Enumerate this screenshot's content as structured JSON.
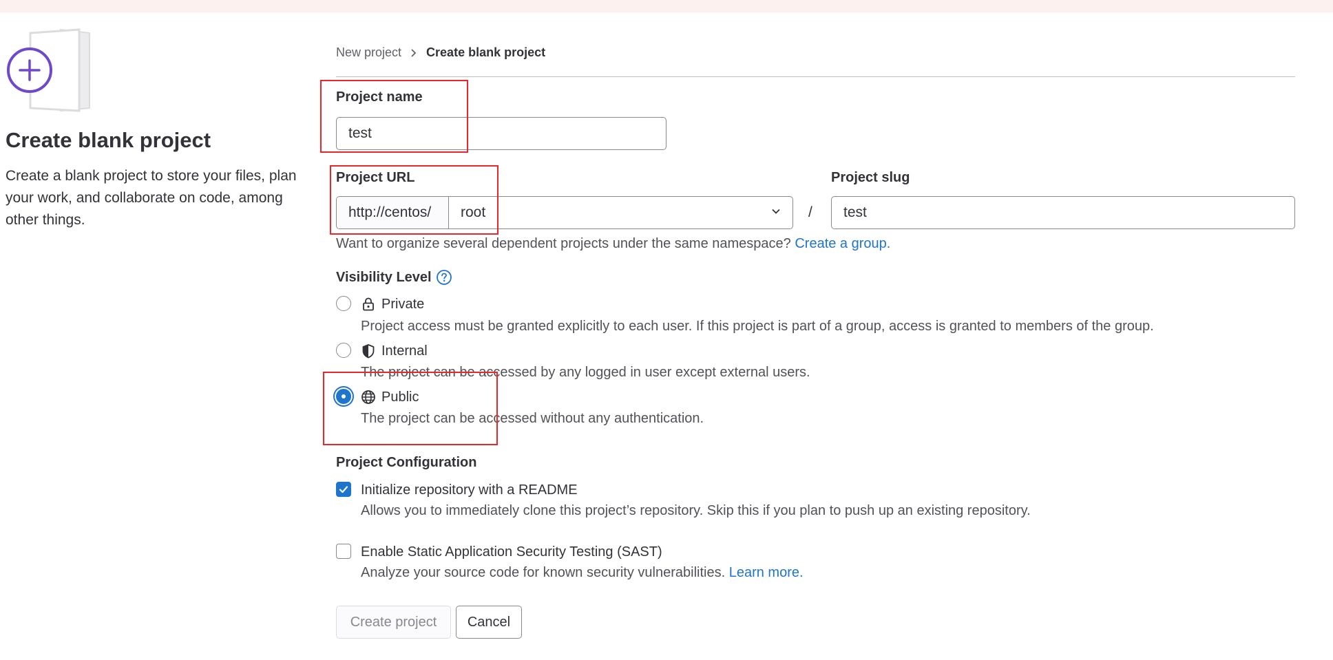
{
  "left_panel": {
    "title": "Create blank project",
    "description": "Create a blank project to store your files, plan your work, and collaborate on code, among other things."
  },
  "breadcrumb": {
    "parent": "New project",
    "current": "Create blank project"
  },
  "form": {
    "project_name_label": "Project name",
    "project_name_value": "test",
    "project_url_label": "Project URL",
    "url_prefix": "http://centos/",
    "namespace": "root",
    "slash": "/",
    "project_slug_label": "Project slug",
    "project_slug_value": "test",
    "namespace_help": "Want to organize several dependent projects under the same namespace?",
    "create_group_link": "Create a group."
  },
  "visibility": {
    "label": "Visibility Level",
    "selected": "Public",
    "options": [
      {
        "label": "Private",
        "description": "Project access must be granted explicitly to each user. If this project is part of a group, access is granted to members of the group.",
        "icon": "lock-icon"
      },
      {
        "label": "Internal",
        "description": "The project can be accessed by any logged in user except external users.",
        "icon": "shield-icon"
      },
      {
        "label": "Public",
        "description": "The project can be accessed without any authentication.",
        "icon": "globe-icon"
      }
    ]
  },
  "configuration": {
    "label": "Project Configuration",
    "readme_label": "Initialize repository with a README",
    "readme_checked": true,
    "readme_help": "Allows you to immediately clone this project’s repository. Skip this if you plan to push up an existing repository.",
    "sast_label": "Enable Static Application Security Testing (SAST)",
    "sast_checked": false,
    "sast_help": "Analyze your source code for known security vulnerabilities.",
    "learn_more_link": "Learn more."
  },
  "buttons": {
    "create": "Create project",
    "cancel": "Cancel"
  },
  "colors": {
    "accent": "#1f75cb",
    "illustration_purple": "#6e49cb",
    "annotation_red": "#e8262b"
  }
}
